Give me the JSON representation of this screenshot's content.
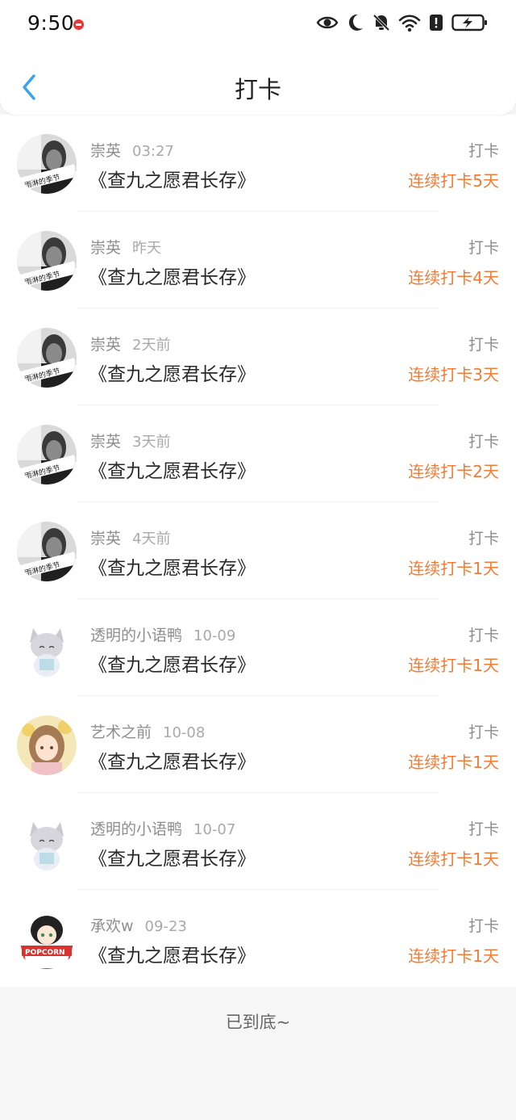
{
  "status_bar": {
    "time": "9:50",
    "icons": [
      "recording-indicator-icon",
      "eye-icon",
      "moon-icon",
      "bell-off-icon",
      "wifi-icon",
      "alert-icon",
      "battery-charging-icon"
    ]
  },
  "header": {
    "back_icon": "chevron-left-icon",
    "title": "打卡"
  },
  "colors": {
    "accent": "#f07b35",
    "back_arrow": "#3aa3ea",
    "muted_text": "#8e8e8e",
    "primary_text": "#2a2a2a",
    "background": "#f7f6f6"
  },
  "checkins": [
    {
      "user": "崇英",
      "time": "03:27",
      "book": "《查九之愿君长存》",
      "tag": "打卡",
      "streak": "连续打卡5天",
      "avatar": "photo-avatar"
    },
    {
      "user": "崇英",
      "time": "昨天",
      "book": "《查九之愿君长存》",
      "tag": "打卡",
      "streak": "连续打卡4天",
      "avatar": "photo-avatar"
    },
    {
      "user": "崇英",
      "time": "2天前",
      "book": "《查九之愿君长存》",
      "tag": "打卡",
      "streak": "连续打卡3天",
      "avatar": "photo-avatar"
    },
    {
      "user": "崇英",
      "time": "3天前",
      "book": "《查九之愿君长存》",
      "tag": "打卡",
      "streak": "连续打卡2天",
      "avatar": "photo-avatar"
    },
    {
      "user": "崇英",
      "time": "4天前",
      "book": "《查九之愿君长存》",
      "tag": "打卡",
      "streak": "连续打卡1天",
      "avatar": "photo-avatar"
    },
    {
      "user": "透明的小语鸭",
      "time": "10-09",
      "book": "《查九之愿君长存》",
      "tag": "打卡",
      "streak": "连续打卡1天",
      "avatar": "cat-avatar"
    },
    {
      "user": "艺术之前",
      "time": "10-08",
      "book": "《查九之愿君长存》",
      "tag": "打卡",
      "streak": "连续打卡1天",
      "avatar": "girl-avatar"
    },
    {
      "user": "透明的小语鸭",
      "time": "10-07",
      "book": "《查九之愿君长存》",
      "tag": "打卡",
      "streak": "连续打卡1天",
      "avatar": "cat-avatar"
    },
    {
      "user": "承欢w",
      "time": "09-23",
      "book": "《查九之愿君长存》",
      "tag": "打卡",
      "streak": "连续打卡1天",
      "avatar": "popcorn-avatar"
    }
  ],
  "footer": {
    "end_text": "已到底~"
  }
}
